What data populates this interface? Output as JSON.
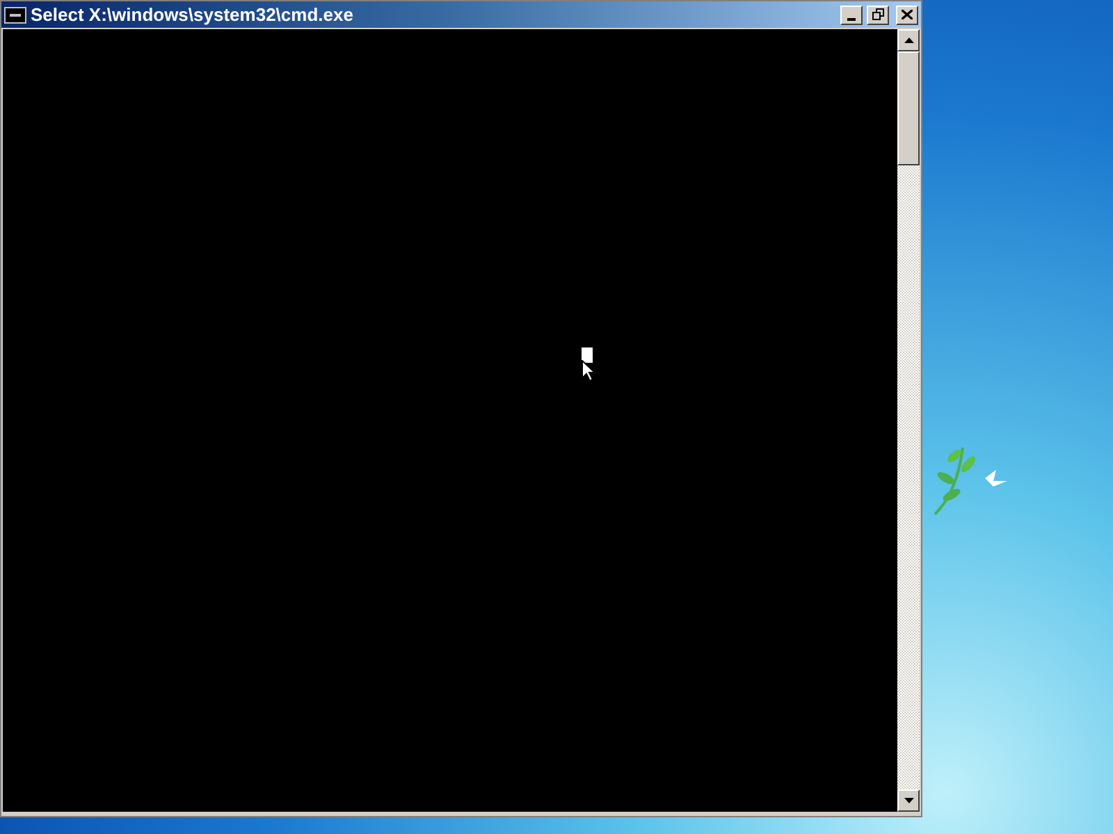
{
  "window": {
    "title": "Select X:\\windows\\system32\\cmd.exe"
  }
}
